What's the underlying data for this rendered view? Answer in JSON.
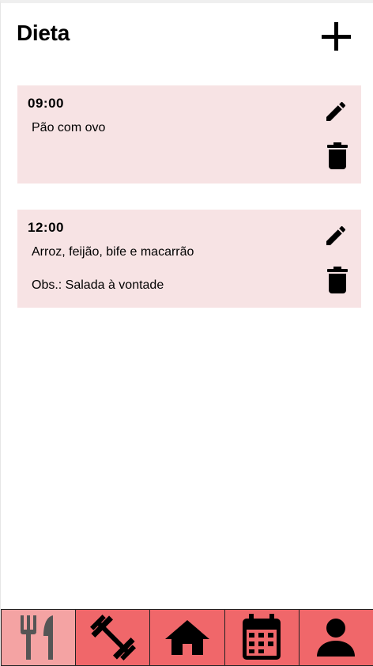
{
  "header": {
    "title": "Dieta",
    "add_icon": "plus-icon"
  },
  "meals": [
    {
      "time": "09:00",
      "description": "Pão com ovo",
      "note": ""
    },
    {
      "time": "12:00",
      "description": "Arroz, feijão, bife e macarrão",
      "note": "Obs.: Salada à vontade"
    }
  ],
  "card_icons": {
    "edit": "pencil-icon",
    "delete": "trash-icon"
  },
  "tabbar": {
    "tabs": [
      {
        "icon": "fork-knife-icon",
        "active": true
      },
      {
        "icon": "dumbbell-icon",
        "active": false
      },
      {
        "icon": "home-icon",
        "active": false
      },
      {
        "icon": "calendar-icon",
        "active": false
      },
      {
        "icon": "user-icon",
        "active": false
      }
    ]
  },
  "colors": {
    "card_bg": "#f7e3e4",
    "tab_bg": "#f0676a",
    "tab_active_bg": "#f4a3a3"
  }
}
